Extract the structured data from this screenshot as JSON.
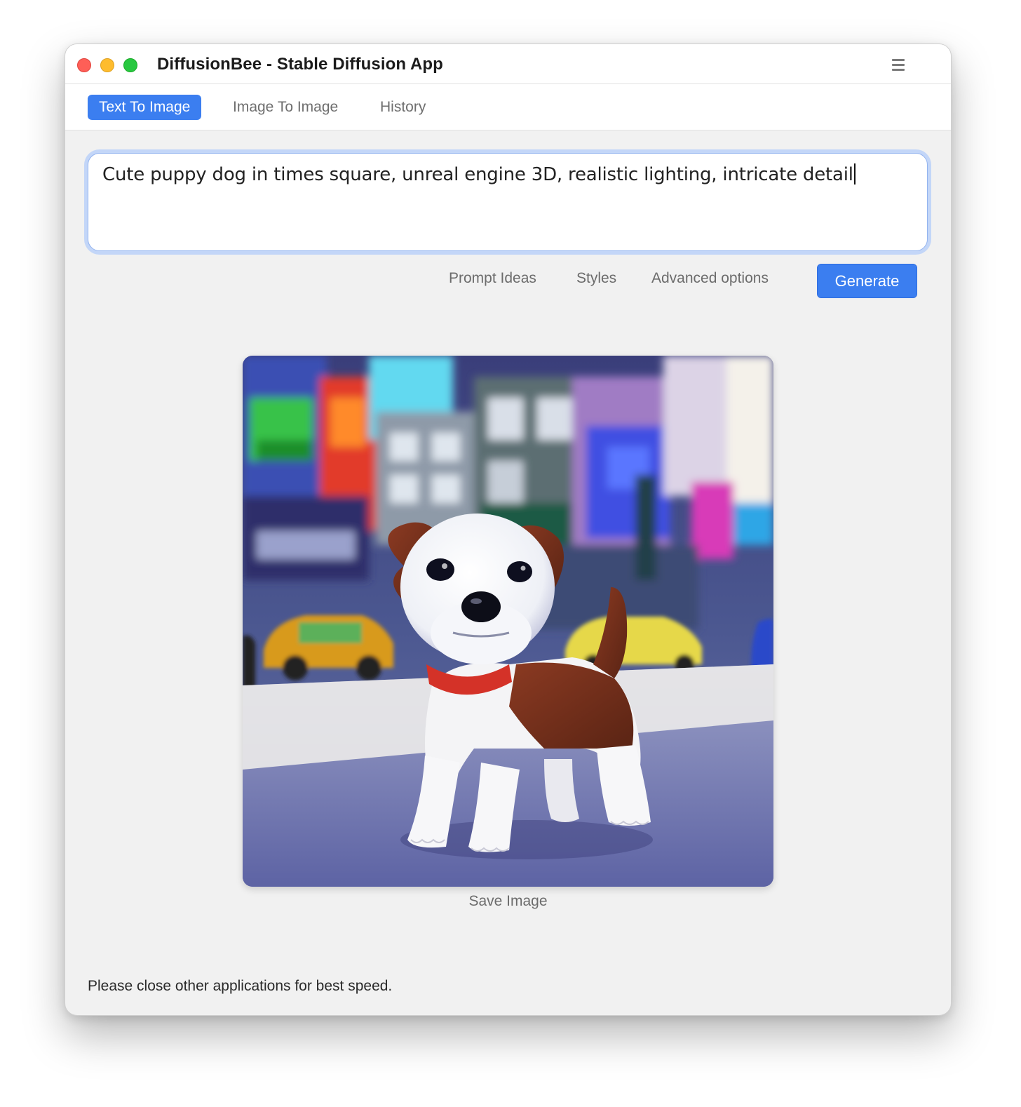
{
  "window": {
    "title": "DiffusionBee - Stable Diffusion App"
  },
  "tabs": [
    {
      "label": "Text To Image",
      "active": true
    },
    {
      "label": "Image To Image",
      "active": false
    },
    {
      "label": "History",
      "active": false
    }
  ],
  "prompt": {
    "value": "Cute puppy dog in times square, unreal engine 3D, realistic lighting, intricate detail"
  },
  "options": {
    "prompt_ideas": "Prompt Ideas",
    "styles": "Styles",
    "advanced": "Advanced options",
    "generate": "Generate"
  },
  "result": {
    "save_label": "Save Image"
  },
  "footer": {
    "message": "Please close other applications for best speed."
  },
  "colors": {
    "accent": "#3b7ef0",
    "background": "#f1f1f1"
  }
}
